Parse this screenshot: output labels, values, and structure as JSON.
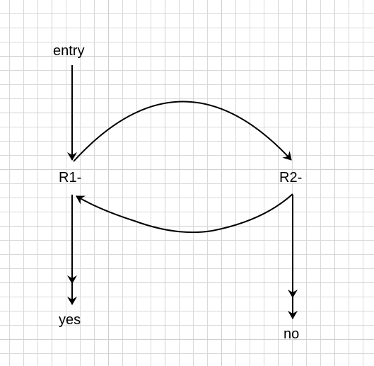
{
  "nodes": {
    "entry": {
      "label": "entry"
    },
    "r1": {
      "label": "R1-"
    },
    "r2": {
      "label": "R2-"
    },
    "yes": {
      "label": "yes"
    },
    "no": {
      "label": "no"
    }
  },
  "edges": [
    {
      "from": "entry",
      "to": "r1"
    },
    {
      "from": "r1",
      "to": "r2"
    },
    {
      "from": "r2",
      "to": "r1"
    },
    {
      "from": "r1",
      "to": "yes"
    },
    {
      "from": "r2",
      "to": "no"
    }
  ],
  "colors": {
    "stroke": "#000000",
    "grid": "#d9d9d9",
    "background": "#ffffff"
  }
}
